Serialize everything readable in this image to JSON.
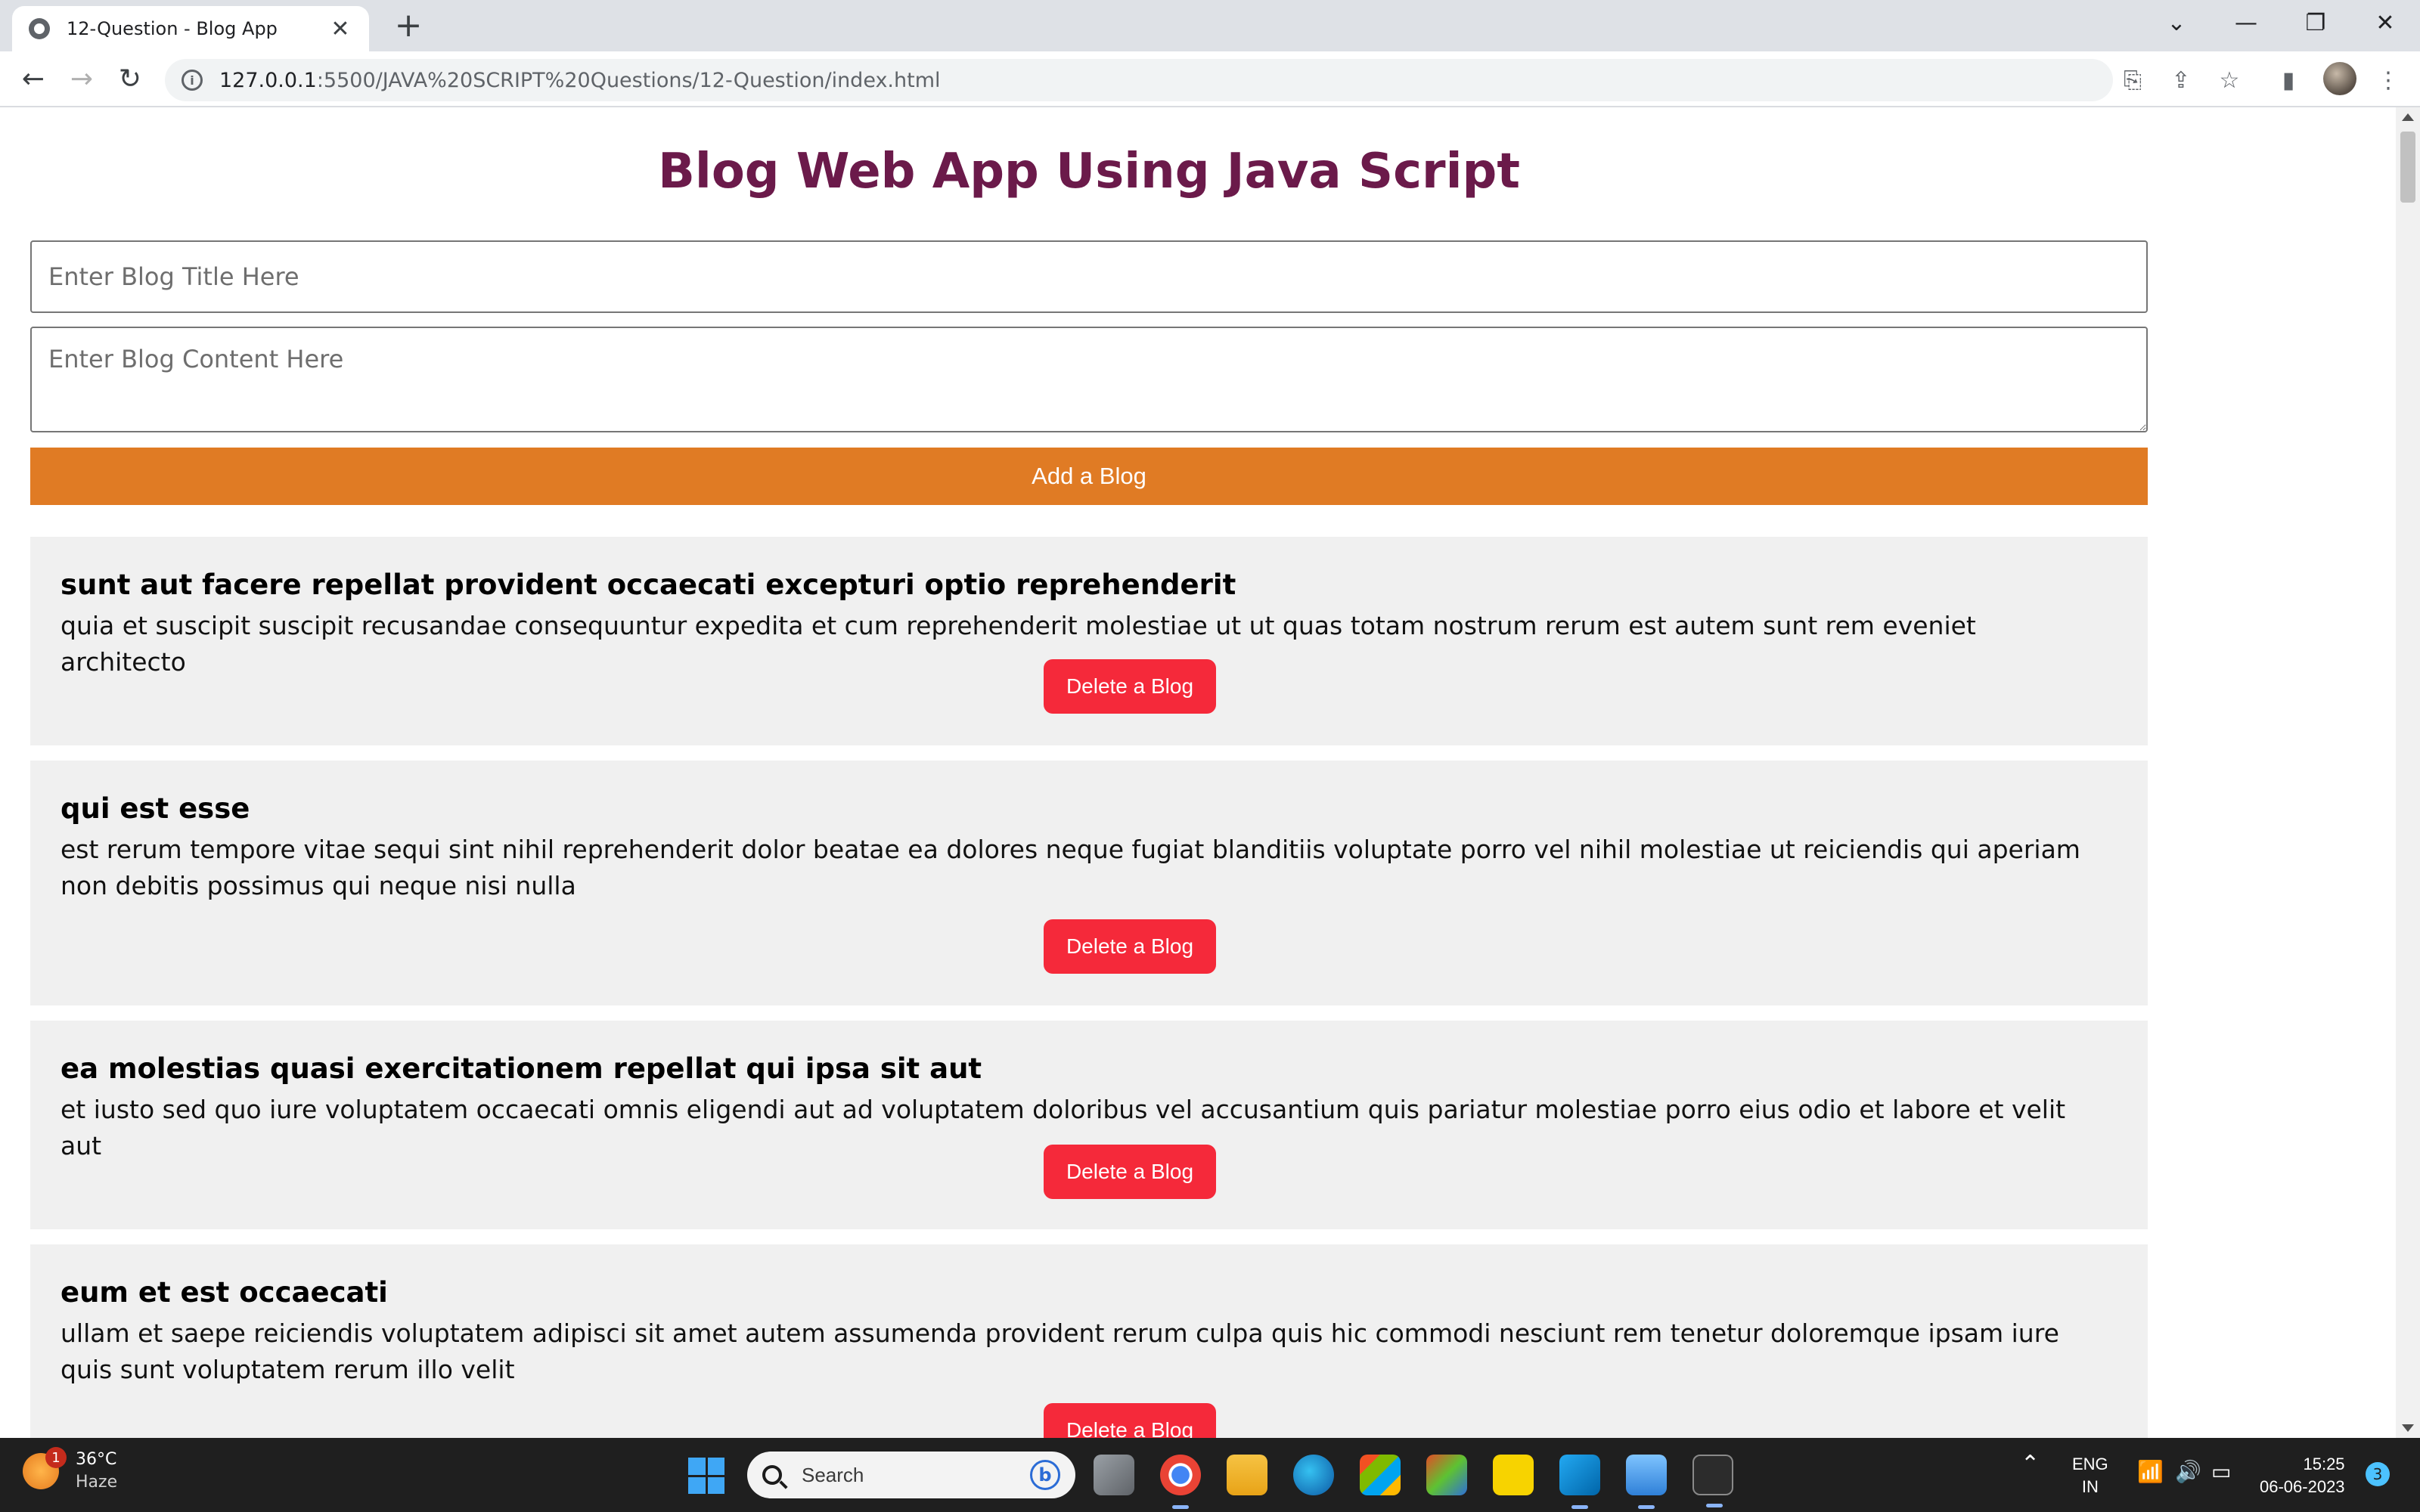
{
  "browser": {
    "tab_title": "12-Question - Blog App",
    "tab_close": "✕",
    "new_tab": "+",
    "url_host": "127.0.0.1",
    "url_path": ":5500/JAVA%20SCRIPT%20Questions/12-Question/index.html"
  },
  "app": {
    "heading": "Blog Web App Using Java Script",
    "title_placeholder": "Enter Blog Title Here",
    "content_placeholder": "Enter Blog Content Here",
    "add_label": "Add a Blog",
    "delete_label": "Delete a Blog",
    "blogs": [
      {
        "title": "sunt aut facere repellat provident occaecati excepturi optio reprehenderit",
        "body": "quia et suscipit suscipit recusandae consequuntur expedita et cum reprehenderit molestiae ut ut quas totam nostrum rerum est autem sunt rem eveniet architecto"
      },
      {
        "title": "qui est esse",
        "body": "est rerum tempore vitae sequi sint nihil reprehenderit dolor beatae ea dolores neque fugiat blanditiis voluptate porro vel nihil molestiae ut reiciendis qui aperiam non debitis possimus qui neque nisi nulla"
      },
      {
        "title": "ea molestias quasi exercitationem repellat qui ipsa sit aut",
        "body": "et iusto sed quo iure voluptatem occaecati omnis eligendi aut ad voluptatem doloribus vel accusantium quis pariatur molestiae porro eius odio et labore et velit aut"
      },
      {
        "title": "eum et est occaecati",
        "body": "ullam et saepe reiciendis voluptatem adipisci sit amet autem assumenda provident rerum culpa quis hic commodi nesciunt rem tenetur doloremque ipsam iure quis sunt voluptatem rerum illo velit"
      }
    ]
  },
  "taskbar": {
    "weather_temp": "36°C",
    "weather_cond": "Haze",
    "weather_badge": "1",
    "search_label": "Search",
    "lang_top": "ENG",
    "lang_bottom": "IN",
    "time": "15:25",
    "date": "06-06-2023",
    "notif_count": "3"
  },
  "colors": {
    "heading": "#6b1a4a",
    "add_button": "#e07b24",
    "delete_button": "#f5293a",
    "card_bg": "#f0f0f0"
  }
}
